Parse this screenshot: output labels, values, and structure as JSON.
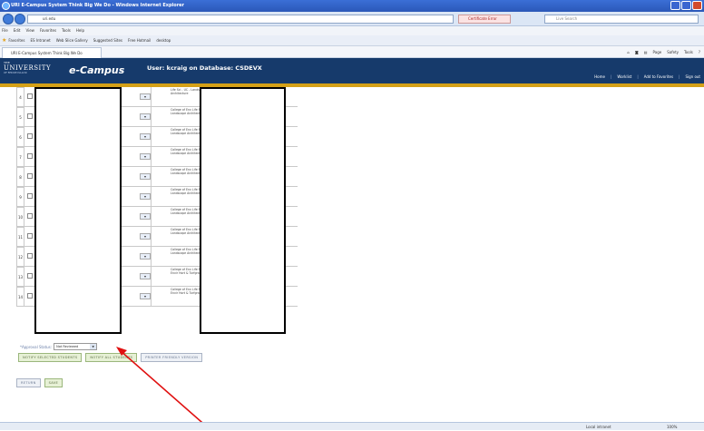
{
  "browser": {
    "title": "URI E-Campus System Think Big We Do - Windows Internet Explorer",
    "address": "uri.edu",
    "cert_error": "Certificate Error",
    "search_placeholder": "Live Search",
    "menu": [
      "File",
      "Edit",
      "View",
      "Favorites",
      "Tools",
      "Help"
    ],
    "favorites_label": "Favorites",
    "favorites": [
      "ES Intranet",
      "Web Slice Gallery",
      "Suggested Sites",
      "Free Hotmail",
      "desktop"
    ],
    "tab_title": "URI E-Campus System Think Big We Do",
    "commands": [
      "Page",
      "Safety",
      "Tools"
    ],
    "status_zone": "Local intranet",
    "status_zoom": "100%"
  },
  "site": {
    "logo_the": "THE",
    "logo_university": "UNIVERSITY",
    "logo_sub": "OF RHODE ISLAND",
    "app_name": "e-Campus",
    "user_info": "User: kcraig on Database: CSDEVX",
    "links": [
      "Home",
      "Worklist",
      "Add to Favorites",
      "Sign out"
    ]
  },
  "rows": [
    {
      "num": "4",
      "college": "Life Sci - UC - Landscape Architecture"
    },
    {
      "num": "5",
      "college": "College of Env Life Sci - UC - Landscape Architecture"
    },
    {
      "num": "6",
      "college": "College of Env Life Sci - UC - Landscape Architecture"
    },
    {
      "num": "7",
      "college": "College of Env Life Sci - UC - Landscape Architecture"
    },
    {
      "num": "8",
      "college": "College of Env Life Sci - UC - Landscape Architecture"
    },
    {
      "num": "9",
      "college": "College of Env Life Sci - UC - Landscape Architecture"
    },
    {
      "num": "10",
      "college": "College of Env Life Sci - UC - Landscape Architecture"
    },
    {
      "num": "11",
      "college": "College of Env Life Sci - UC - Landscape Architecture"
    },
    {
      "num": "12",
      "college": "College of Env Life Sci - UC - Landscape Architecture"
    },
    {
      "num": "13",
      "college": "College of Env Life Sci - UC - Envir Hort & Turfgrass Mgmt"
    },
    {
      "num": "14",
      "college": "College of Env Life Sci - UC - Envir Hort & Turfgrass Mgmt"
    }
  ],
  "form": {
    "approval_label": "*Approval Status:",
    "approval_value": "Not Reviewed",
    "notify_selected": "NOTIFY SELECTED STUDENTS",
    "notify_all": "NOTIFY ALL STUDENTS",
    "printer_friendly": "PRINTER FRIENDLY VERSION",
    "return": "RETURN",
    "save": "SAVE"
  }
}
